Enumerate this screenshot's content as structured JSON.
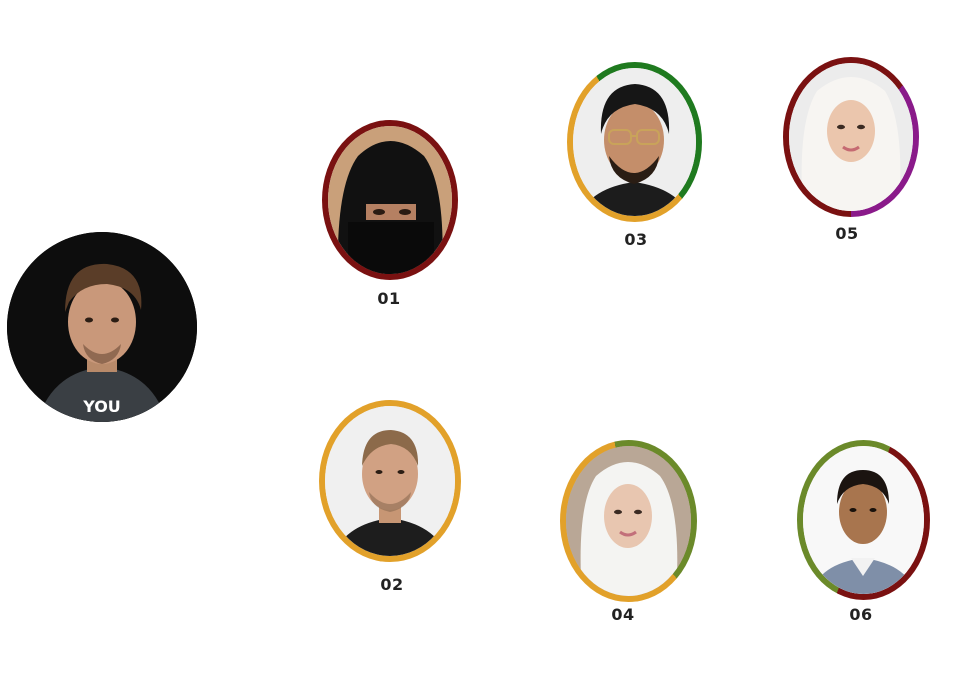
{
  "you": {
    "label": "YOU"
  },
  "contacts": [
    {
      "id": "01",
      "ring_colors": [
        "#7a1111"
      ]
    },
    {
      "id": "02",
      "ring_colors": [
        "#e2a12a"
      ]
    },
    {
      "id": "03",
      "ring_colors": [
        "#1f7a1f",
        "#e2a12a"
      ]
    },
    {
      "id": "04",
      "ring_colors": [
        "#6b8a2a",
        "#e2a12a"
      ]
    },
    {
      "id": "05",
      "ring_colors": [
        "#7a1111",
        "#8a1a8a"
      ]
    },
    {
      "id": "06",
      "ring_colors": [
        "#6b8a2a",
        "#7a1111"
      ]
    }
  ]
}
